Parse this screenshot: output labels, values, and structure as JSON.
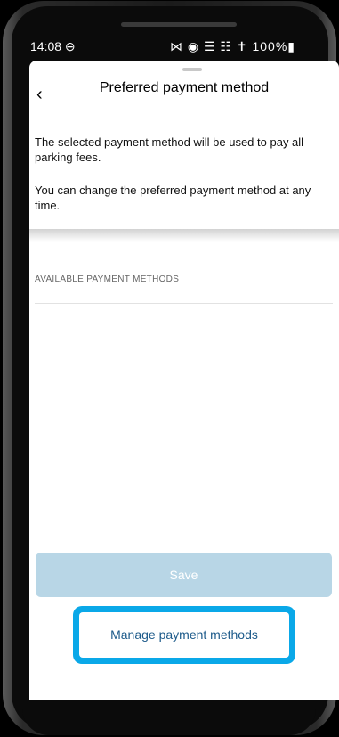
{
  "status_bar": {
    "time": "14:08 ⊖",
    "indicators": "⋈ ◉ ☰ ☷ ✝ 100%▮"
  },
  "header": {
    "back_icon": "‹",
    "title": "Preferred payment method"
  },
  "content": {
    "description_1": "The selected payment method will be used to pay all parking fees.",
    "description_2": "You can change the preferred payment method at any time.",
    "section_label": "AVAILABLE PAYMENT METHODS"
  },
  "buttons": {
    "save_label": "Save",
    "manage_label": "Manage payment methods"
  },
  "colors": {
    "save_disabled_bg": "#b8d6e6",
    "highlight": "#0aa8e8",
    "link_text": "#1c5a8a"
  }
}
